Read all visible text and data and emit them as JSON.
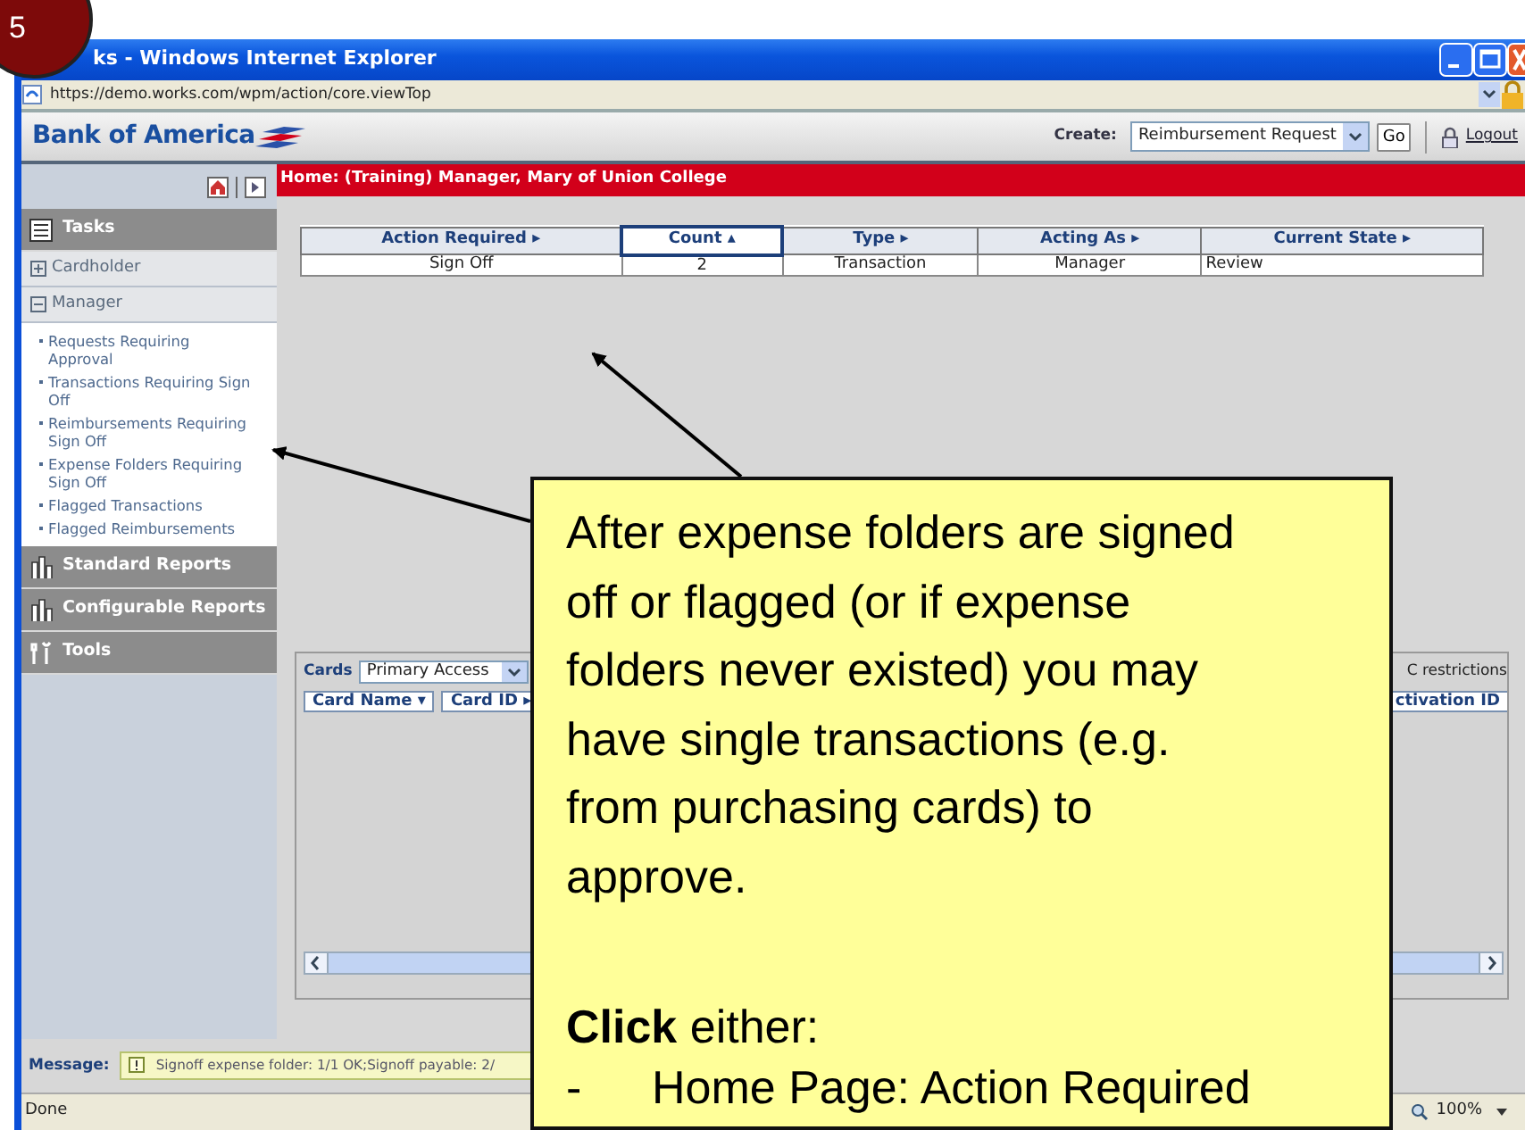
{
  "step_badge": "5",
  "window": {
    "title": "ks - Windows Internet Explorer"
  },
  "address_bar": {
    "url": "https://demo.works.com/wpm/action/core.viewTop"
  },
  "header": {
    "logo": "Bank of America",
    "create_label": "Create:",
    "create_select": "Reimbursement Request",
    "go_button": "Go",
    "logout": "Logout"
  },
  "breadcrumb": "Home: (Training) Manager, Mary of Union College",
  "sidebar": {
    "items": [
      {
        "kind": "heading",
        "label": "Tasks"
      },
      {
        "kind": "group",
        "label": "Cardholder",
        "expanded": false
      },
      {
        "kind": "group",
        "label": "Manager",
        "expanded": true,
        "children": [
          {
            "label": "Requests Requiring Approval"
          },
          {
            "label": "Transactions Requiring Sign Off"
          },
          {
            "label": "Reimbursements Requiring Sign Off"
          },
          {
            "label": "Expense Folders Requiring Sign Off"
          },
          {
            "label": "Flagged Transactions"
          },
          {
            "label": "Flagged Reimbursements"
          }
        ]
      },
      {
        "kind": "heading",
        "label": "Standard Reports"
      },
      {
        "kind": "heading",
        "label": "Configurable Reports"
      },
      {
        "kind": "heading",
        "label": "Tools"
      }
    ]
  },
  "action_table": {
    "columns": [
      {
        "label": "Action Required",
        "sort_mark": "▸",
        "selected": false
      },
      {
        "label": "Count",
        "sort_mark": "▴",
        "selected": true
      },
      {
        "label": "Type",
        "sort_mark": "▸",
        "selected": false
      },
      {
        "label": "Acting As",
        "sort_mark": "▸",
        "selected": false
      },
      {
        "label": "Current State",
        "sort_mark": "▸",
        "selected": false
      }
    ],
    "rows": [
      [
        "Sign Off",
        "2",
        "Transaction",
        "Manager",
        "Review"
      ]
    ]
  },
  "cards_panel": {
    "label": "Cards",
    "filter": "Primary Access",
    "columns": [
      {
        "label": "Card Name",
        "sort_mark": "▾"
      },
      {
        "label": "Card ID",
        "sort_mark": "▸"
      }
    ],
    "right_text": "C restrictions",
    "right_column": "ctivation ID"
  },
  "message": {
    "label": "Message:",
    "text": "Signoff expense folder: 1/1 OK;Signoff payable: 2/"
  },
  "status_bar": {
    "text": "Done",
    "zoom": "100%"
  },
  "callout": {
    "text": "After expense folders are signed off or flagged (or if expense folders never existed) you may have single transactions (e.g. from purchasing cards) to approve.",
    "instruction": "**Click** either:",
    "list": [
      {
        "marker": "-",
        "text": "Home Page: Action Required"
      }
    ]
  }
}
